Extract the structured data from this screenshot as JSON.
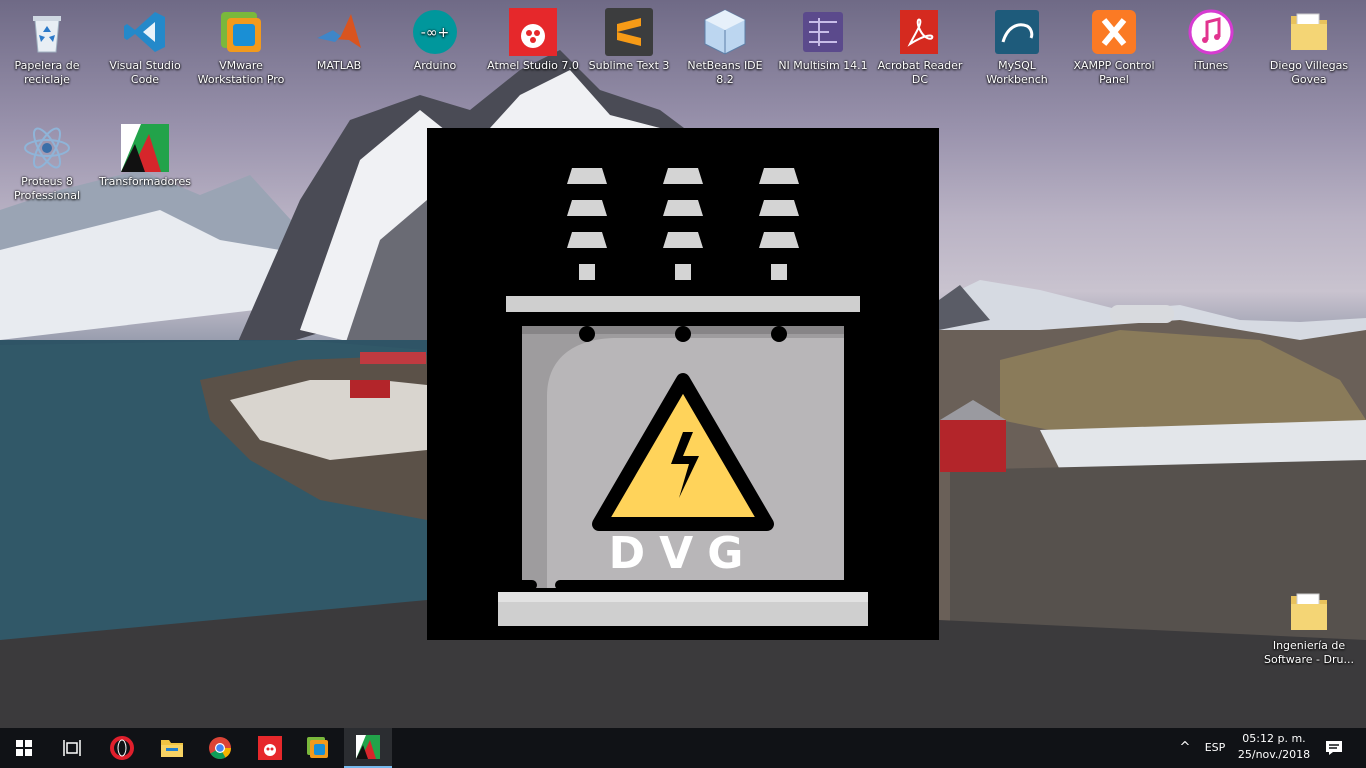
{
  "desktop": {
    "icons": [
      {
        "label": "Papelera de reciclaje",
        "icon": "recycle-bin-icon"
      },
      {
        "label": "Visual Studio Code",
        "icon": "vscode-icon"
      },
      {
        "label": "VMware Workstation Pro",
        "icon": "vmware-icon"
      },
      {
        "label": "MATLAB",
        "icon": "matlab-icon"
      },
      {
        "label": "Arduino",
        "icon": "arduino-icon"
      },
      {
        "label": "Atmel Studio 7.0",
        "icon": "atmel-icon"
      },
      {
        "label": "Sublime Text 3",
        "icon": "sublime-icon"
      },
      {
        "label": "NetBeans IDE 8.2",
        "icon": "netbeans-icon"
      },
      {
        "label": "NI Multisim 14.1",
        "icon": "multisim-icon"
      },
      {
        "label": "Acrobat Reader DC",
        "icon": "acrobat-icon"
      },
      {
        "label": "MySQL Workbench",
        "icon": "mysql-icon"
      },
      {
        "label": "XAMPP Control Panel",
        "icon": "xampp-icon"
      },
      {
        "label": "iTunes",
        "icon": "itunes-icon"
      },
      {
        "label": "Diego Villegas Govea",
        "icon": "folder-icon"
      },
      {
        "label": "Proteus 8 Professional",
        "icon": "proteus-icon"
      },
      {
        "label": "Transformadores",
        "icon": "transformadores-icon"
      },
      {
        "label": "Ingeniería de Software - Dru...",
        "icon": "folder-icon"
      }
    ]
  },
  "splash": {
    "text": "DVG",
    "icon": "transformer-high-voltage-icon",
    "colors": {
      "background": "#000000",
      "warning": "#ffd35a",
      "body": "#9e9c9e",
      "light": "#d4d4d4"
    }
  },
  "taskbar": {
    "apps": [
      {
        "name": "start-button",
        "icon": "windows-logo-icon"
      },
      {
        "name": "task-view-button",
        "icon": "task-view-icon"
      },
      {
        "name": "opera-button",
        "icon": "opera-icon"
      },
      {
        "name": "file-explorer-button",
        "icon": "folder-icon"
      },
      {
        "name": "chrome-button",
        "icon": "chrome-icon"
      },
      {
        "name": "atmel-studio-button",
        "icon": "atmel-icon"
      },
      {
        "name": "vmware-button",
        "icon": "vmware-icon"
      },
      {
        "name": "transformadores-button",
        "icon": "transformadores-icon",
        "active": true
      }
    ],
    "tray": {
      "chevron": "^",
      "language": "ESP",
      "time": "05:12 p. m.",
      "date": "25/nov./2018",
      "notification_icon": "action-center-icon"
    }
  }
}
